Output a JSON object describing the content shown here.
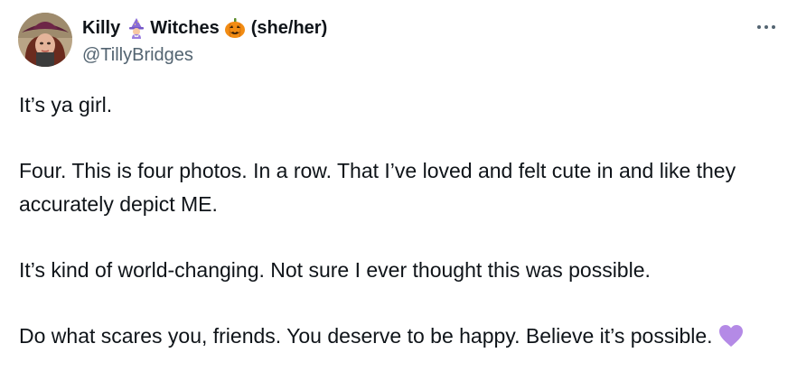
{
  "author": {
    "name_part1": "Killy",
    "name_part2": "Witches",
    "pronouns": "(she/her)",
    "handle": "@TillyBridges",
    "name_emojis": [
      "mage-icon",
      "jack-o-lantern-icon"
    ]
  },
  "menu": {
    "icon": "more-dots-icon"
  },
  "tweet": {
    "paragraphs": [
      "It’s ya girl.",
      "Four. This is four photos. In a row. That I’ve loved and felt cute in and like they accurately depict ME.",
      "It’s kind of world-changing. Not sure I ever thought this was possible.",
      "Do what scares you, friends. You deserve to be happy. Believe it’s possible."
    ],
    "end_emoji": "purple-heart-icon"
  },
  "colors": {
    "text": "#0f1419",
    "secondary": "#536471",
    "heart": "#b48ae6",
    "pumpkin": "#f28c13"
  }
}
